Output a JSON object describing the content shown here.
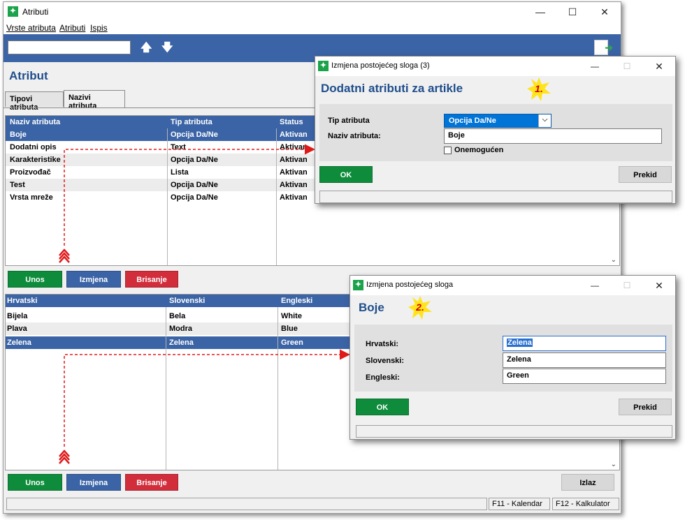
{
  "window": {
    "title": "Atributi",
    "controls": {
      "minimize": "—",
      "maximize": "☐",
      "close": "✕"
    }
  },
  "menu": [
    "Vrste atributa",
    "Atributi",
    "Ispis"
  ],
  "toolbar": {
    "search_value": "",
    "up_icon": "arrow-up-icon",
    "down_icon": "arrow-down-icon",
    "exit_icon": "exit-icon"
  },
  "section_title": "Atribut",
  "tabs": [
    "Tipovi atributa",
    "Nazivi atributa"
  ],
  "attributes_table": {
    "columns": [
      "Naziv atributa",
      "Tip atributa",
      "Status"
    ],
    "rows": [
      [
        "Boje",
        "Opcija Da/Ne",
        "Aktivan"
      ],
      [
        "Dodatni opis",
        "Text",
        "Aktivan"
      ],
      [
        "Karakteristike",
        "Opcija Da/Ne",
        "Aktivan"
      ],
      [
        "Proizvođač",
        "Lista",
        "Aktivan"
      ],
      [
        "Test",
        "Opcija Da/Ne",
        "Aktivan"
      ],
      [
        "Vrsta mreže",
        "Opcija Da/Ne",
        "Aktivan"
      ]
    ]
  },
  "buttons_top": {
    "unos": "Unos",
    "izmjena": "Izmjena",
    "brisanje": "Brisanje"
  },
  "translations_table": {
    "columns": [
      "Hrvatski",
      "Slovenski",
      "Engleski"
    ],
    "rows": [
      [
        "Bijela",
        "Bela",
        "White"
      ],
      [
        "Plava",
        "Modra",
        "Blue"
      ],
      [
        "Zelena",
        "Zelena",
        "Green"
      ]
    ]
  },
  "buttons_bottom": {
    "unos": "Unos",
    "izmjena": "Izmjena",
    "brisanje": "Brisanje",
    "izlaz": "Izlaz"
  },
  "statusbar": {
    "f11": "F11 - Kalendar",
    "f12": "F12 - Kalkulator"
  },
  "dialog1": {
    "title": "Izmjena postojećeg sloga  (3)",
    "heading": "Dodatni atributi za artikle",
    "badge": "1.",
    "tip_label": "Tip atributa",
    "tip_value": "Opcija Da/Ne",
    "naziv_label": "Naziv atributa:",
    "naziv_value": "Boje",
    "checkbox_label": "Onemogućen",
    "ok": "OK",
    "cancel": "Prekid"
  },
  "dialog2": {
    "title": "Izmjena postojećeg sloga",
    "heading": "Boje",
    "badge": "2.",
    "hr_label": "Hrvatski:",
    "hr_value": "Zelena",
    "sl_label": "Slovenski:",
    "sl_value": "Zelena",
    "en_label": "Engleski:",
    "en_value": "Green",
    "ok": "OK",
    "cancel": "Prekid"
  },
  "colors": {
    "header_blue": "#3b64a6",
    "green": "#0e8c3c",
    "red": "#d22d3b",
    "annotation_red": "#e01a1a",
    "badge_yellow": "#ffe41a"
  }
}
